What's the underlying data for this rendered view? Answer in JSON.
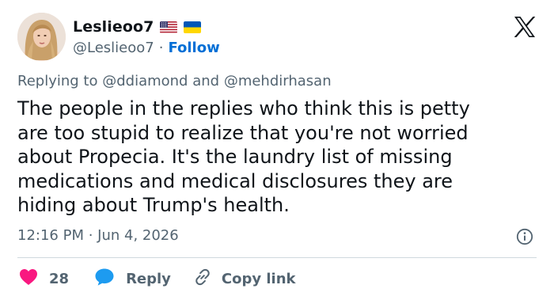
{
  "user": {
    "display_name": "Leslieoo7",
    "handle": "@Leslieoo7",
    "separator": "·",
    "follow_label": "Follow",
    "badges": [
      "us-flag-icon",
      "ukraine-flag-icon"
    ]
  },
  "reply_to": {
    "prefix": "Replying to",
    "mention_1": "@ddiamond",
    "conjunction": "and",
    "mention_2": "@mehdirhasan"
  },
  "tweet": {
    "text": "The people in the replies who think this is petty\nare too stupid to realize that you're not worried\nabout Propecia. It's the laundry list of missing\nmedications and medical disclosures they are\nhiding about Trump's health.",
    "timestamp": "12:16 PM · Jun 4, 2026"
  },
  "actions": {
    "like_count": "28",
    "reply_label": "Reply",
    "copy_link_label": "Copy link"
  },
  "colors": {
    "like": "#f91880",
    "reply": "#1d9bf0",
    "follow": "#006fd6",
    "secondary_text": "#536471",
    "divider": "#cfd9de"
  },
  "icons": {
    "logo": "x-logo-icon",
    "info": "info-icon",
    "like": "heart-icon",
    "reply": "speech-bubble-icon",
    "copy_link": "link-icon"
  }
}
